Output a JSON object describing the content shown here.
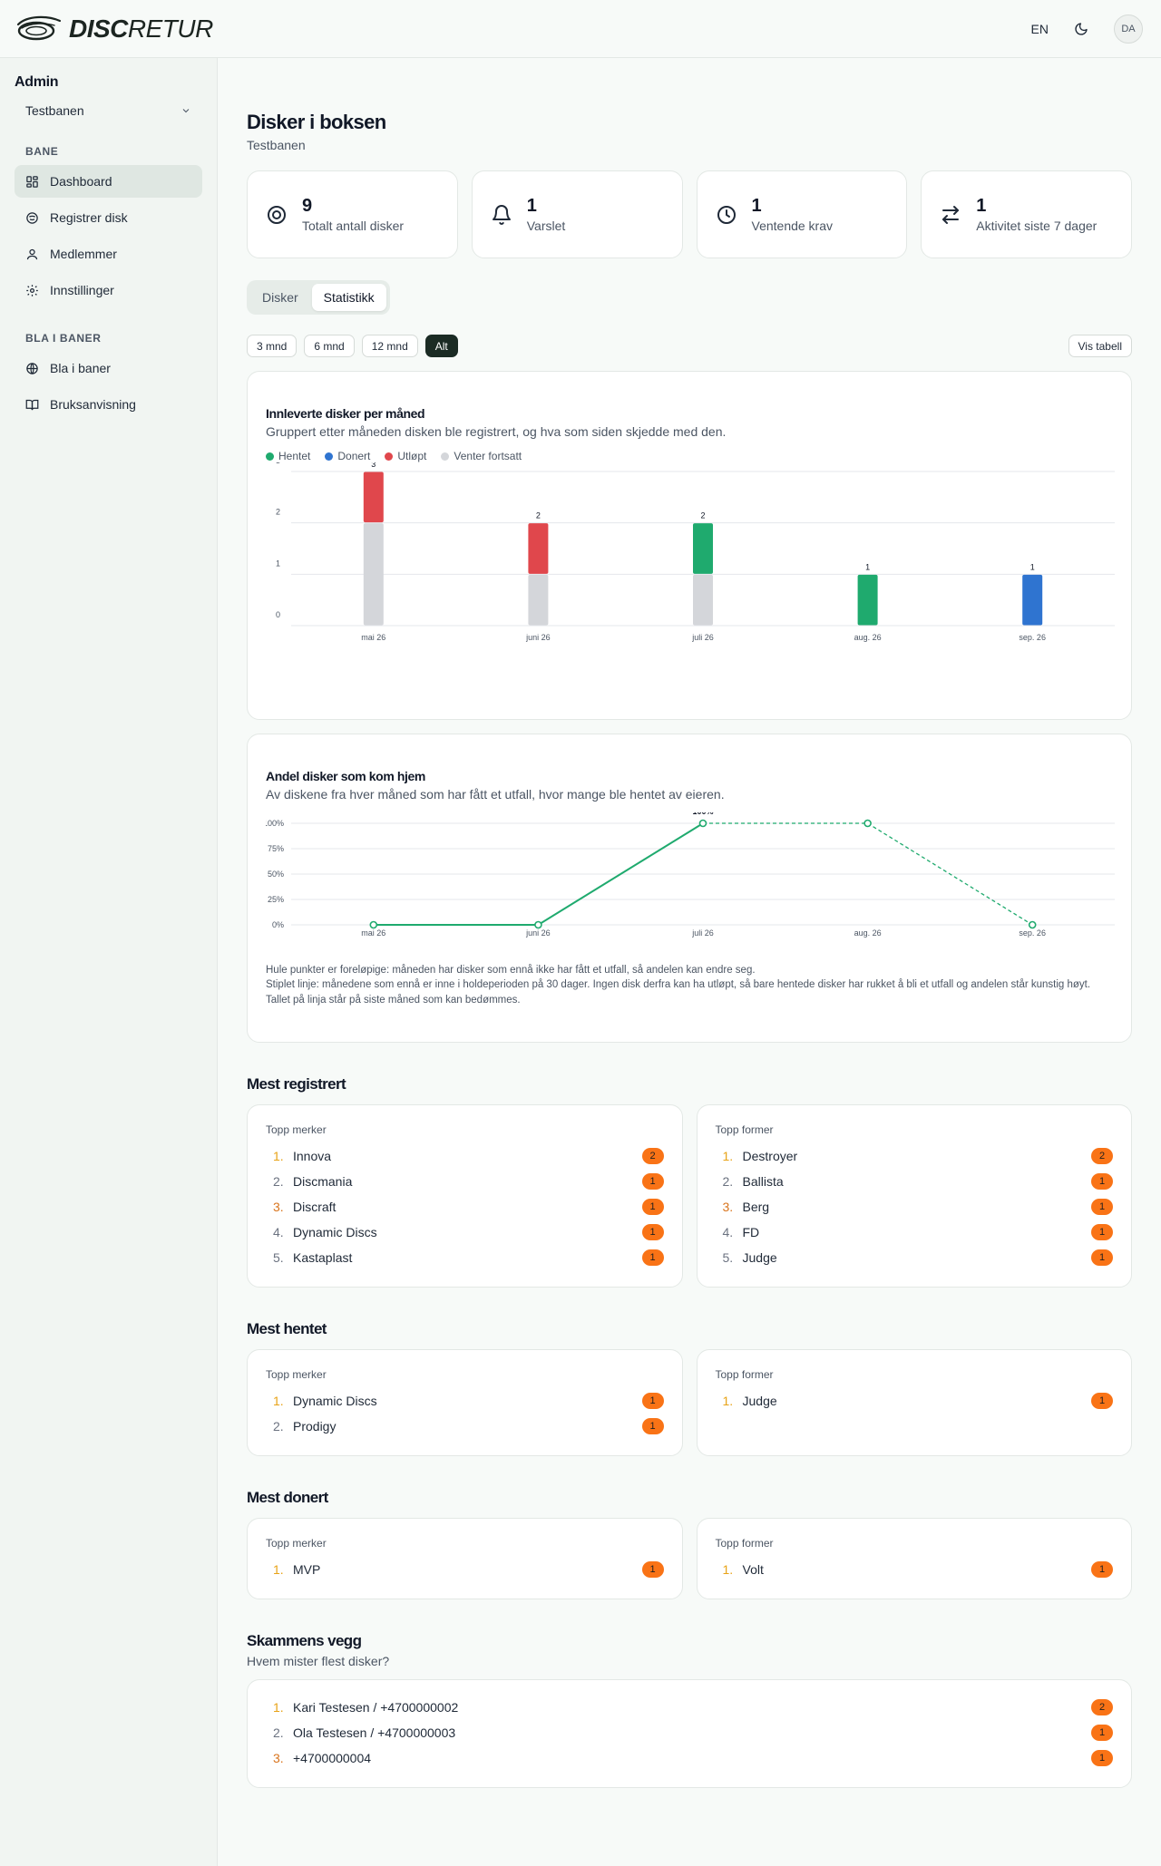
{
  "header": {
    "logo_bold": "DISC",
    "logo_light": "RETUR",
    "lang": "EN",
    "avatar": "DA"
  },
  "sidebar": {
    "title": "Admin",
    "course_select": "Testbanen",
    "sections": [
      {
        "label": "BANE",
        "items": [
          {
            "label": "Dashboard",
            "icon": "grid-icon",
            "active": true
          },
          {
            "label": "Registrer disk",
            "icon": "disc-icon"
          },
          {
            "label": "Medlemmer",
            "icon": "user-icon"
          },
          {
            "label": "Innstillinger",
            "icon": "gear-icon"
          }
        ]
      },
      {
        "label": "BLA I BANER",
        "items": [
          {
            "label": "Bla i baner",
            "icon": "globe-icon"
          },
          {
            "label": "Bruksanvisning",
            "icon": "book-icon"
          }
        ]
      }
    ]
  },
  "page": {
    "title": "Disker i boksen",
    "subtitle": "Testbanen"
  },
  "stats": [
    {
      "value": "9",
      "label": "Totalt antall disker",
      "icon": "disc-icon"
    },
    {
      "value": "1",
      "label": "Varslet",
      "icon": "bell-icon"
    },
    {
      "value": "1",
      "label": "Ventende krav",
      "icon": "clock-icon"
    },
    {
      "value": "1",
      "label": "Aktivitet siste 7 dager",
      "icon": "arrows-swap-icon"
    }
  ],
  "tabs": [
    {
      "label": "Disker"
    },
    {
      "label": "Statistikk",
      "active": true
    }
  ],
  "filters": [
    "3 mnd",
    "6 mnd",
    "12 mnd",
    "Alt"
  ],
  "filter_active": "Alt",
  "view_table": "Vis tabell",
  "colors": {
    "hentet": "#1faa6e",
    "donert": "#2f74d0",
    "utlopt": "#e0474c",
    "venter": "#d4d6da",
    "accent": "#1b2b24",
    "badge": "#f97316"
  },
  "chart_data": [
    {
      "type": "bar",
      "stacked": true,
      "title": "Innleverte disker per måned",
      "subtitle": "Gruppert etter måneden disken ble registrert, og hva som siden skjedde med den.",
      "categories": [
        "mai 26",
        "juni 26",
        "juli 26",
        "aug. 26",
        "sep. 26"
      ],
      "series": [
        {
          "name": "Hentet",
          "values": [
            0,
            0,
            1,
            1,
            0
          ]
        },
        {
          "name": "Donert",
          "values": [
            0,
            0,
            0,
            0,
            1
          ]
        },
        {
          "name": "Utløpt",
          "values": [
            1,
            1,
            0,
            0,
            0
          ]
        },
        {
          "name": "Venter fortsatt",
          "values": [
            2,
            1,
            1,
            0,
            0
          ]
        }
      ],
      "totals": [
        3,
        2,
        2,
        1,
        1
      ],
      "ylim": [
        0,
        3
      ],
      "yticks": [
        0,
        1,
        2,
        3
      ],
      "grid": true,
      "legend": "top-left"
    },
    {
      "type": "line",
      "title": "Andel disker som kom hjem",
      "subtitle": "Av diskene fra hver måned som har fått et utfall, hvor mange ble hentet av eieren.",
      "categories": [
        "mai 26",
        "juni 26",
        "juli 26",
        "aug. 26",
        "sep. 26"
      ],
      "values": [
        0,
        0,
        100,
        100,
        0
      ],
      "dashed_from_index": 2,
      "point_label": "100%",
      "yticks": [
        "0%",
        "25%",
        "50%",
        "75%",
        "100%"
      ],
      "ylim": [
        0,
        100
      ],
      "grid": true
    }
  ],
  "line_notes": [
    "Hule punkter er foreløpige: måneden har disker som ennå ikke har fått et utfall, så andelen kan endre seg.",
    "Stiplet linje: månedene som ennå er inne i holdeperioden på 30 dager. Ingen disk derfra kan ha utløpt, så bare hentede disker har rukket å bli et utfall og andelen står kunstig høyt. Tallet på linja står på siste måned som kan bedømmes."
  ],
  "groups": [
    {
      "title": "Mest registrert",
      "brands": {
        "head": "Topp merker",
        "items": [
          {
            "rank": "1.",
            "name": "Innova",
            "count": "2"
          },
          {
            "rank": "2.",
            "name": "Discmania",
            "count": "1"
          },
          {
            "rank": "3.",
            "name": "Discraft",
            "count": "1"
          },
          {
            "rank": "4.",
            "name": "Dynamic Discs",
            "count": "1"
          },
          {
            "rank": "5.",
            "name": "Kastaplast",
            "count": "1"
          }
        ]
      },
      "molds": {
        "head": "Topp former",
        "items": [
          {
            "rank": "1.",
            "name": "Destroyer",
            "count": "2"
          },
          {
            "rank": "2.",
            "name": "Ballista",
            "count": "1"
          },
          {
            "rank": "3.",
            "name": "Berg",
            "count": "1"
          },
          {
            "rank": "4.",
            "name": "FD",
            "count": "1"
          },
          {
            "rank": "5.",
            "name": "Judge",
            "count": "1"
          }
        ]
      }
    },
    {
      "title": "Mest hentet",
      "brands": {
        "head": "Topp merker",
        "items": [
          {
            "rank": "1.",
            "name": "Dynamic Discs",
            "count": "1"
          },
          {
            "rank": "2.",
            "name": "Prodigy",
            "count": "1"
          }
        ]
      },
      "molds": {
        "head": "Topp former",
        "items": [
          {
            "rank": "1.",
            "name": "Judge",
            "count": "1"
          }
        ]
      }
    },
    {
      "title": "Mest donert",
      "brands": {
        "head": "Topp merker",
        "items": [
          {
            "rank": "1.",
            "name": "MVP",
            "count": "1"
          }
        ]
      },
      "molds": {
        "head": "Topp former",
        "items": [
          {
            "rank": "1.",
            "name": "Volt",
            "count": "1"
          }
        ]
      }
    }
  ],
  "shame": {
    "title": "Skammens vegg",
    "subtitle": "Hvem mister flest disker?",
    "items": [
      {
        "rank": "1.",
        "name": "Kari Testesen / +4700000002",
        "count": "2"
      },
      {
        "rank": "2.",
        "name": "Ola Testesen / +4700000003",
        "count": "1"
      },
      {
        "rank": "3.",
        "name": "+4700000004",
        "count": "1"
      }
    ]
  }
}
